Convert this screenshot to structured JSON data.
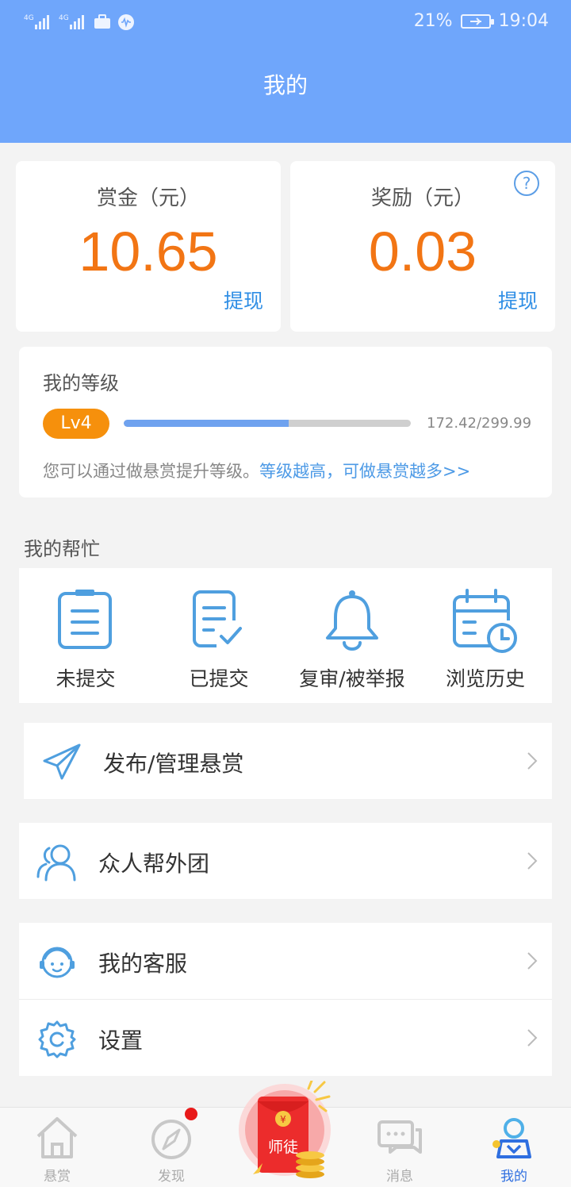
{
  "status_bar": {
    "battery": "21%",
    "time": "19:04",
    "network_1": "4G",
    "network_2": "4G"
  },
  "header": {
    "title": "我的"
  },
  "bounty_card": {
    "label": "赏金（元）",
    "value": "10.65",
    "withdraw": "提现"
  },
  "reward_card": {
    "label": "奖励（元）",
    "value": "0.03",
    "withdraw": "提现",
    "help": "?"
  },
  "level": {
    "title": "我的等级",
    "badge": "Lv4",
    "progress_text": "172.42/299.99",
    "progress_fraction": 0.5747,
    "desc": "您可以通过做悬赏提升等级。",
    "link": "等级越高，可做悬赏越多>>"
  },
  "my_help": {
    "title": "我的帮忙",
    "items": [
      {
        "label": "未提交",
        "icon": "clipboard-icon"
      },
      {
        "label": "已提交",
        "icon": "clipboard-check-icon"
      },
      {
        "label": "复审/被举报",
        "icon": "bell-icon"
      },
      {
        "label": "浏览历史",
        "icon": "calendar-clock-icon"
      }
    ]
  },
  "menu": {
    "publish": "发布/管理悬赏",
    "team": "众人帮外团",
    "service": "我的客服",
    "settings": "设置"
  },
  "tabbar": {
    "tabs": [
      {
        "label": "悬赏",
        "icon": "home-icon"
      },
      {
        "label": "发现",
        "icon": "compass-icon"
      },
      {
        "label": "师徒",
        "icon": "red-envelope-icon"
      },
      {
        "label": "消息",
        "icon": "chat-icon"
      },
      {
        "label": "我的",
        "icon": "user-icon"
      }
    ],
    "envelope_glyph": "¥"
  },
  "colors": {
    "header": "#6fa6fb",
    "accent_orange": "#f27514",
    "link_blue": "#2f8ee5",
    "badge_orange": "#f6900c",
    "icon_blue": "#4f9fdf"
  }
}
